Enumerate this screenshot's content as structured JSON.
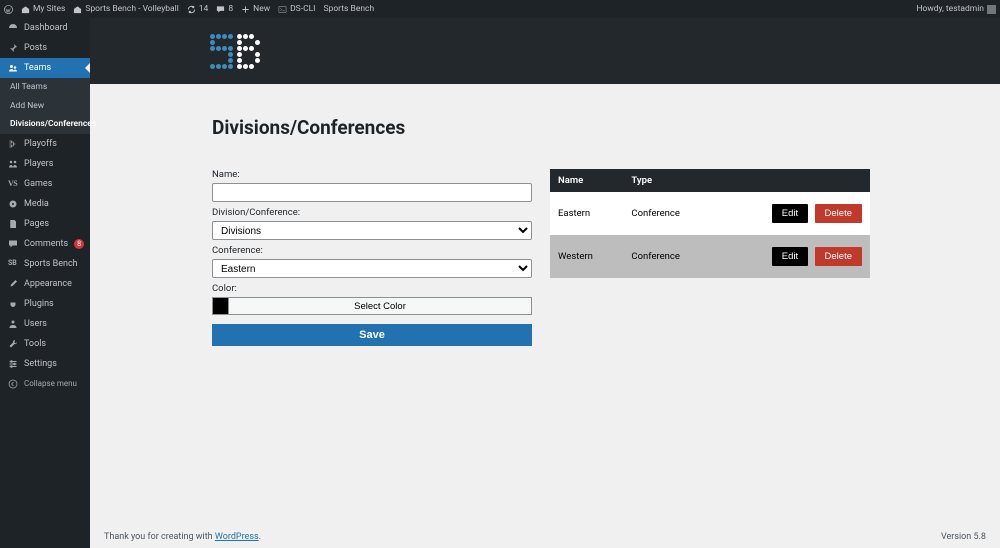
{
  "adminbar": {
    "my_sites": "My Sites",
    "site_name": "Sports Bench - Volleyball",
    "update_count": "14",
    "comment_count": "8",
    "new_label": "New",
    "dscli": "DS-CLI",
    "sportsbench": "Sports Bench",
    "howdy": "Howdy, testadmin"
  },
  "sidebar": {
    "dashboard": "Dashboard",
    "posts": "Posts",
    "teams": "Teams",
    "sub_allteams": "All Teams",
    "sub_addnew": "Add New",
    "sub_divconf": "Divisions/Conferences",
    "playoffs": "Playoffs",
    "players": "Players",
    "games": "Games",
    "media": "Media",
    "pages": "Pages",
    "comments": "Comments",
    "comments_badge": "8",
    "sportsbench": "Sports Bench",
    "appearance": "Appearance",
    "plugins": "Plugins",
    "users": "Users",
    "tools": "Tools",
    "settings": "Settings",
    "collapse": "Collapse menu"
  },
  "page": {
    "title": "Divisions/Conferences"
  },
  "form": {
    "name_label": "Name:",
    "name_value": "",
    "divconf_label": "Division/Conference:",
    "divconf_value": "Divisions",
    "conference_label": "Conference:",
    "conference_value": "Eastern",
    "color_label": "Color:",
    "color_button": "Select Color",
    "save_label": "Save"
  },
  "table": {
    "col_name": "Name",
    "col_type": "Type",
    "edit_label": "Edit",
    "delete_label": "Delete",
    "rows": [
      {
        "name": "Eastern",
        "type": "Conference"
      },
      {
        "name": "Western",
        "type": "Conference"
      }
    ]
  },
  "footer": {
    "thanks_prefix": "Thank you for creating with ",
    "wp": "WordPress",
    "thanks_suffix": ".",
    "version": "Version 5.8"
  }
}
